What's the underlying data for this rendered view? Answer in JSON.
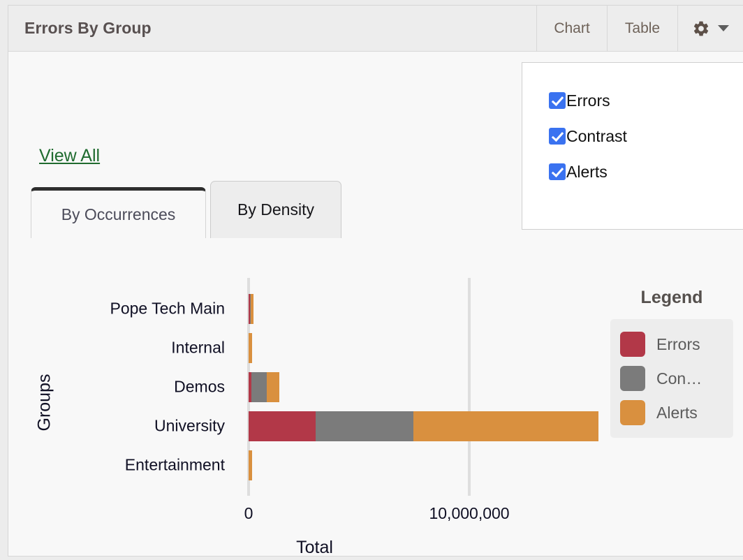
{
  "header": {
    "title": "Errors By Group",
    "chart_button": "Chart",
    "table_button": "Table",
    "gear_icon": "gear-icon",
    "caret_icon": "chevron-down-icon"
  },
  "settings_menu": {
    "options": [
      {
        "label": "Errors",
        "checked": true
      },
      {
        "label": "Contrast",
        "checked": true
      },
      {
        "label": "Alerts",
        "checked": true
      }
    ],
    "checkbox_color": "#3a72f0"
  },
  "body": {
    "view_all_link": "View All",
    "view_all_color": "#1f6b2f",
    "tabs": [
      {
        "label": "By Occurrences",
        "active": true
      },
      {
        "label": "By Density",
        "active": false
      }
    ]
  },
  "legend": {
    "title": "Legend",
    "items": [
      {
        "label": "Errors",
        "color": "#b23848"
      },
      {
        "label": "Con…",
        "color": "#7b7b7b"
      },
      {
        "label": "Alerts",
        "color": "#d9903f"
      }
    ]
  },
  "chart_data": {
    "type": "bar",
    "orientation": "horizontal",
    "stacked": true,
    "title": "",
    "xlabel": "Total",
    "ylabel": "Groups",
    "xlim": [
      0,
      21200000
    ],
    "xticks": [
      0,
      10000000
    ],
    "xtick_labels": [
      "0",
      "10,000,000"
    ],
    "grid": true,
    "legend_position": "right",
    "categories": [
      "Pope Tech Main",
      "Internal",
      "Demos",
      "University",
      "Entertainment"
    ],
    "series": [
      {
        "name": "Errors",
        "color": "#b23848",
        "values": [
          60000,
          0,
          130000,
          3040000,
          0
        ]
      },
      {
        "name": "Contrast",
        "color": "#7b7b7b",
        "values": [
          50000,
          0,
          680000,
          4440000,
          0
        ]
      },
      {
        "name": "Alerts",
        "color": "#d9903f",
        "values": [
          110000,
          170000,
          570000,
          8370000,
          170000
        ]
      }
    ]
  }
}
